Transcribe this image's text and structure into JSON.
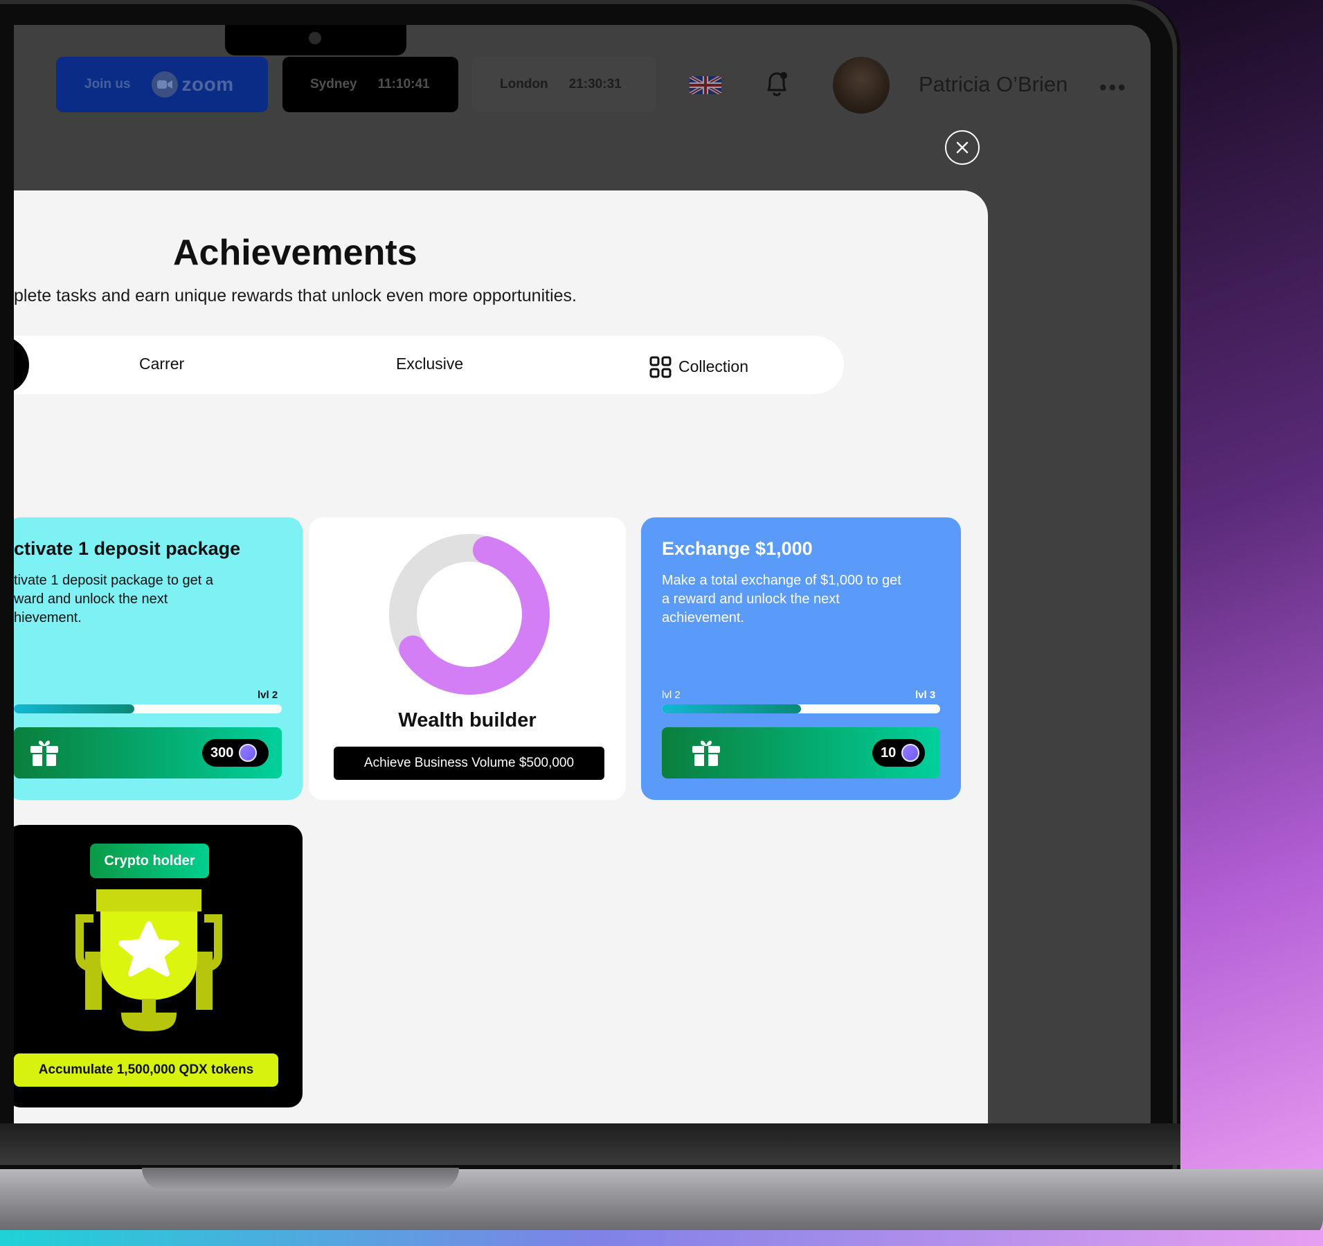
{
  "topbar": {
    "zoom": {
      "join_label": "Join us",
      "logo_text": "zoom"
    },
    "clock_sydney": {
      "city": "Sydney",
      "time": "11:10:41"
    },
    "clock_london": {
      "city": "London",
      "time": "21:30:31"
    },
    "language_flag": "uk-flag-icon",
    "user_name": "Patricia O’Brien",
    "more_label": "•••"
  },
  "modal": {
    "title": "Achievements",
    "subtitle": "plete tasks and earn unique rewards that unlock even more opportunities.",
    "tabs": [
      {
        "label": "Carrer"
      },
      {
        "label": "Exclusive"
      },
      {
        "label": "Collection"
      }
    ]
  },
  "cards": {
    "deposit": {
      "title": "ctivate 1 deposit package",
      "desc_lines": [
        "tivate 1 deposit package to get a",
        "ward and unlock the next",
        "hievement."
      ],
      "level_to": "lvl 2",
      "progress": 0.45,
      "reward": "300"
    },
    "wealth": {
      "title": "Wealth builder",
      "badge": "Achieve Business Volume $500,000",
      "progress": 0.62
    },
    "exchange": {
      "title": "Exchange $1,000",
      "desc_lines": [
        "Make a total exchange of $1,000 to get",
        "a reward and unlock the next",
        "achievement."
      ],
      "level_from": "lvl 2",
      "level_to": "lvl 3",
      "progress": 0.5,
      "reward": "10"
    },
    "crypto": {
      "badge": "Crypto holder",
      "goal": "Accumulate 1,500,000 QDX tokens"
    }
  },
  "colors": {
    "card_cyan": "#7df1f4",
    "card_blue": "#5a9bf9",
    "donut_purple": "#d37ef5",
    "reward_green": "#01d09b",
    "qdx_yellow": "#d8f20f"
  }
}
